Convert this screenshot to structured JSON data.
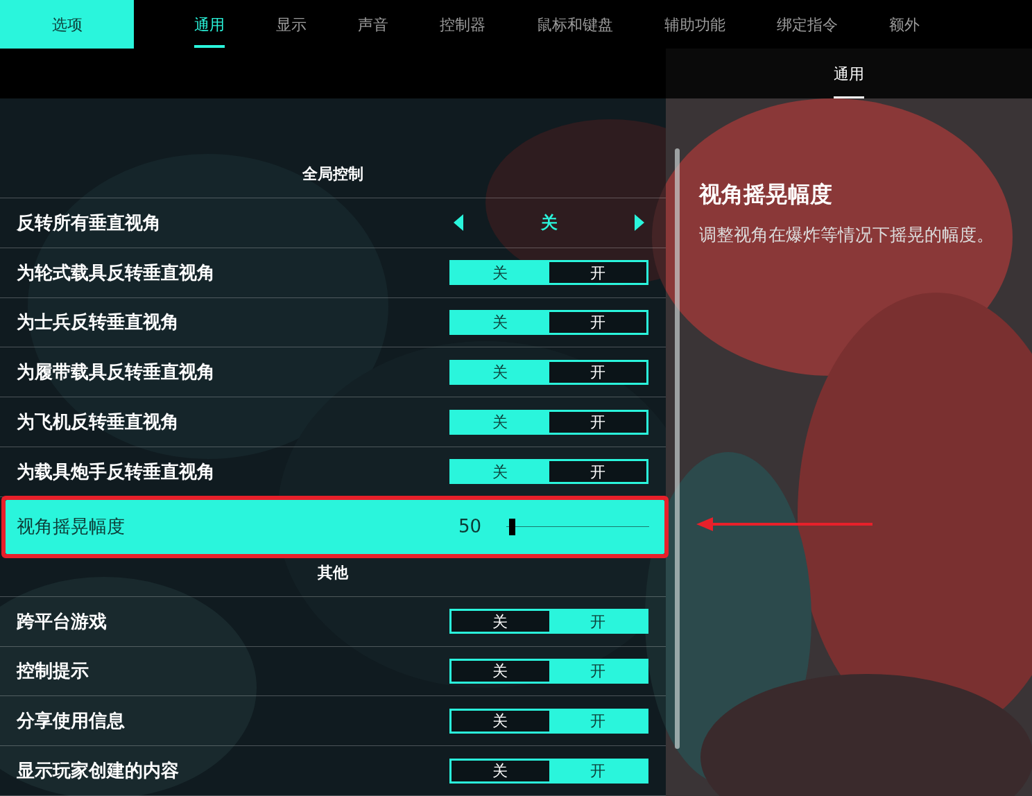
{
  "header": {
    "title": "选项"
  },
  "tabs": [
    {
      "label": "通用",
      "selected": true
    },
    {
      "label": "显示",
      "selected": false
    },
    {
      "label": "声音",
      "selected": false
    },
    {
      "label": "控制器",
      "selected": false
    },
    {
      "label": "鼠标和键盘",
      "selected": false
    },
    {
      "label": "辅助功能",
      "selected": false
    },
    {
      "label": "绑定指令",
      "selected": false
    },
    {
      "label": "额外",
      "selected": false
    }
  ],
  "subtabs": [
    {
      "label": "通用",
      "selected": true
    }
  ],
  "sections": [
    {
      "title": "全局控制",
      "rows": [
        {
          "kind": "option",
          "label": "反转所有垂直视角",
          "value": "关",
          "selected": false
        },
        {
          "kind": "toggle",
          "label": "为轮式载具反转垂直视角",
          "selected": false,
          "options": [
            {
              "label": "关",
              "selected": true
            },
            {
              "label": "开",
              "selected": false
            }
          ]
        },
        {
          "kind": "toggle",
          "label": "为士兵反转垂直视角",
          "selected": false,
          "options": [
            {
              "label": "关",
              "selected": true
            },
            {
              "label": "开",
              "selected": false
            }
          ]
        },
        {
          "kind": "toggle",
          "label": "为履带载具反转垂直视角",
          "selected": false,
          "options": [
            {
              "label": "关",
              "selected": true
            },
            {
              "label": "开",
              "selected": false
            }
          ]
        },
        {
          "kind": "toggle",
          "label": "为飞机反转垂直视角",
          "selected": false,
          "options": [
            {
              "label": "关",
              "selected": true
            },
            {
              "label": "开",
              "selected": false
            }
          ]
        },
        {
          "kind": "toggle",
          "label": "为载具炮手反转垂直视角",
          "selected": false,
          "options": [
            {
              "label": "关",
              "selected": true
            },
            {
              "label": "开",
              "selected": false
            }
          ]
        },
        {
          "kind": "slider",
          "label": "视角摇晃幅度",
          "value": "50",
          "level": 0.02,
          "selected": true,
          "marked": true
        }
      ]
    },
    {
      "title": "其他",
      "rows": [
        {
          "kind": "toggle",
          "label": "跨平台游戏",
          "selected": false,
          "options": [
            {
              "label": "关",
              "selected": false
            },
            {
              "label": "开",
              "selected": true
            }
          ]
        },
        {
          "kind": "toggle",
          "label": "控制提示",
          "selected": false,
          "options": [
            {
              "label": "关",
              "selected": false
            },
            {
              "label": "开",
              "selected": true
            }
          ]
        },
        {
          "kind": "toggle",
          "label": "分享使用信息",
          "selected": false,
          "options": [
            {
              "label": "关",
              "selected": false
            },
            {
              "label": "开",
              "selected": true
            }
          ]
        },
        {
          "kind": "toggle",
          "label": "显示玩家创建的内容",
          "selected": false,
          "options": [
            {
              "label": "关",
              "selected": false
            },
            {
              "label": "开",
              "selected": true
            }
          ]
        }
      ]
    }
  ],
  "detail": {
    "title": "视角摇晃幅度",
    "description": "调整视角在爆炸等情况下摇晃的幅度。"
  }
}
